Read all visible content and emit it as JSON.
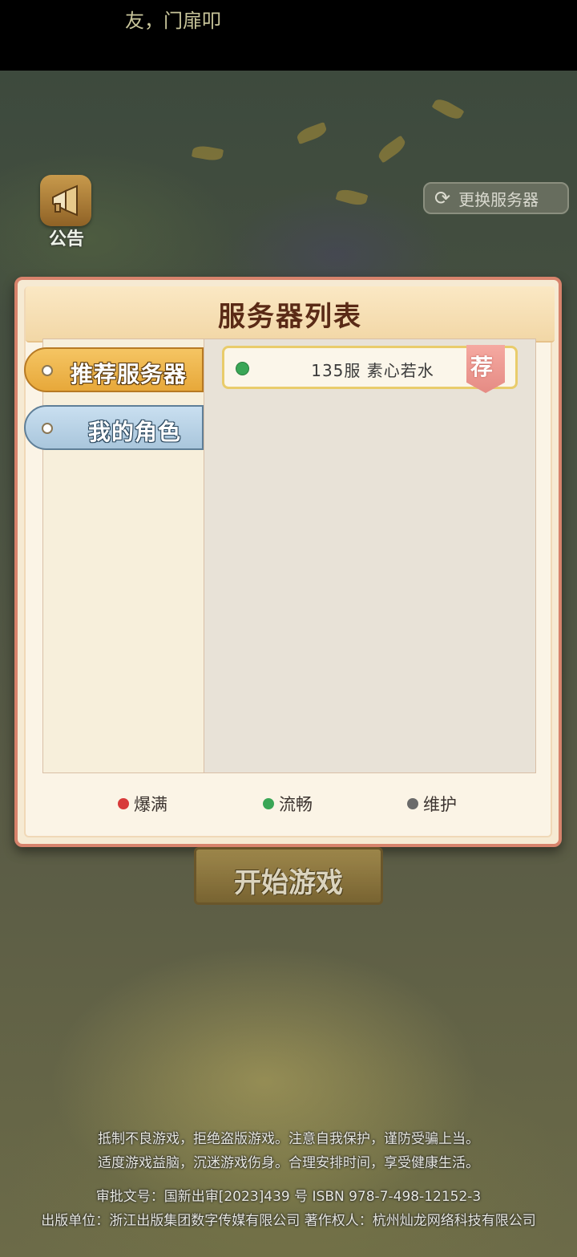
{
  "top_notice": "友，门扉叩",
  "announcement": {
    "label": "公告",
    "icon": "megaphone-icon"
  },
  "switch_server": {
    "label": "更换服务器",
    "icon": "swap-icon"
  },
  "modal": {
    "title": "服务器列表",
    "tabs": [
      {
        "label": "推荐服务器",
        "selected": true
      },
      {
        "label": "我的角色",
        "selected": false
      }
    ],
    "servers": [
      {
        "name": "135服 素心若水",
        "status": "流畅",
        "status_color": "#3aa656",
        "badge": "荐"
      }
    ],
    "legend": [
      {
        "label": "爆满",
        "color": "#d83a3a"
      },
      {
        "label": "流畅",
        "color": "#3aa656"
      },
      {
        "label": "维护",
        "color": "#6a6a6a"
      }
    ]
  },
  "start_button": {
    "label": "开始游戏"
  },
  "footer": {
    "line1": "抵制不良游戏，拒绝盗版游戏。注意自我保护，谨防受骗上当。",
    "line2": "适度游戏益脑，沉迷游戏伤身。合理安排时间，享受健康生活。",
    "line3": "审批文号：国新出审[2023]439 号  ISBN 978-7-498-12152-3",
    "line4": "出版单位：浙江出版集团数字传媒有限公司  著作权人：杭州灿龙网络科技有限公司"
  }
}
